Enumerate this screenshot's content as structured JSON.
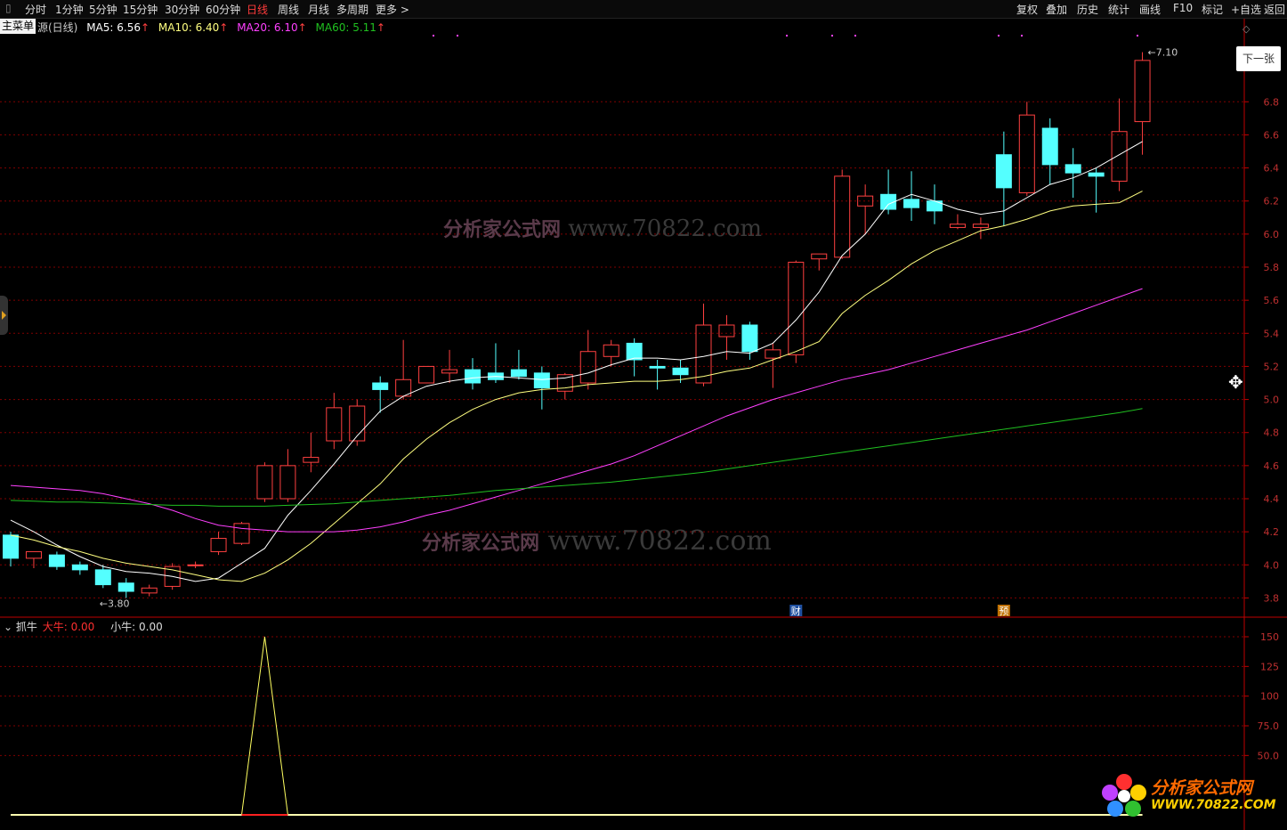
{
  "toolbar": {
    "periods": [
      "分时",
      "1分钟",
      "5分钟",
      "15分钟",
      "30分钟",
      "60分钟",
      "日线",
      "周线",
      "月线",
      "多周期",
      "更多 >"
    ],
    "active_period": "日线",
    "right_tools": [
      "复权",
      "叠加",
      "历史",
      "统计",
      "画线",
      "F10",
      "标记",
      "+自选",
      "返回"
    ]
  },
  "main_menu_label": "主菜单",
  "next_button_label": "下一张",
  "main_legend": {
    "title": "源(日线)",
    "ma5": "MA5: 6.56",
    "ma10": "MA10: 6.40",
    "ma20": "MA20: 6.10",
    "ma60": "MA60: 5.11"
  },
  "sub_legend": {
    "title": "抓牛",
    "big": "大牛: 0.00",
    "small": "小牛: 0.00"
  },
  "markers": {
    "cai": "财",
    "yu": "预"
  },
  "watermark": {
    "site": "www.70822.com",
    "brand": "分析家公式网",
    "brand_url": "WWW.70822.COM"
  },
  "colors": {
    "up": "#ff4040",
    "down": "#54ffff",
    "ma5": "#ffffff",
    "ma10": "#ffff80",
    "ma20": "#ff40ff",
    "ma60": "#20c020",
    "grid": "#800000",
    "axis": "#c00000"
  },
  "chart_data": [
    {
      "type": "candlestick",
      "title": "",
      "ylim": [
        3.7,
        7.2
      ],
      "yticks": [
        3.8,
        4.0,
        4.2,
        4.4,
        4.6,
        4.8,
        5.0,
        5.2,
        5.4,
        5.6,
        5.8,
        6.0,
        6.2,
        6.4,
        6.6,
        6.8
      ],
      "annotations": {
        "high": "7.10",
        "low": "3.80"
      },
      "ohlc": [
        [
          4.18,
          4.2,
          3.99,
          4.04
        ],
        [
          4.04,
          4.08,
          3.98,
          4.08
        ],
        [
          4.06,
          4.08,
          3.97,
          3.99
        ],
        [
          4.0,
          4.02,
          3.94,
          3.97
        ],
        [
          3.97,
          4.0,
          3.86,
          3.88
        ],
        [
          3.89,
          3.92,
          3.8,
          3.84
        ],
        [
          3.83,
          3.88,
          3.81,
          3.86
        ],
        [
          3.87,
          4.01,
          3.85,
          3.99
        ],
        [
          4.0,
          4.02,
          3.98,
          4.0
        ],
        [
          4.08,
          4.2,
          4.06,
          4.16
        ],
        [
          4.13,
          4.26,
          4.12,
          4.25
        ],
        [
          4.4,
          4.62,
          4.38,
          4.6
        ],
        [
          4.4,
          4.7,
          4.38,
          4.6
        ],
        [
          4.62,
          4.8,
          4.56,
          4.65
        ],
        [
          4.75,
          5.04,
          4.7,
          4.95
        ],
        [
          4.75,
          5.0,
          4.72,
          4.96
        ],
        [
          5.1,
          5.14,
          4.92,
          5.06
        ],
        [
          5.02,
          5.36,
          5.0,
          5.12
        ],
        [
          5.1,
          5.2,
          5.1,
          5.2
        ],
        [
          5.16,
          5.3,
          5.1,
          5.18
        ],
        [
          5.18,
          5.25,
          5.06,
          5.1
        ],
        [
          5.16,
          5.34,
          5.1,
          5.12
        ],
        [
          5.18,
          5.3,
          5.12,
          5.14
        ],
        [
          5.16,
          5.2,
          4.94,
          5.07
        ],
        [
          5.05,
          5.16,
          5.0,
          5.15
        ],
        [
          5.1,
          5.42,
          5.06,
          5.29
        ],
        [
          5.26,
          5.36,
          5.2,
          5.33
        ],
        [
          5.34,
          5.37,
          5.14,
          5.24
        ],
        [
          5.2,
          5.24,
          5.06,
          5.19
        ],
        [
          5.19,
          5.24,
          5.1,
          5.15
        ],
        [
          5.1,
          5.58,
          5.08,
          5.45
        ],
        [
          5.38,
          5.51,
          5.24,
          5.45
        ],
        [
          5.45,
          5.47,
          5.24,
          5.29
        ],
        [
          5.25,
          5.34,
          5.07,
          5.3
        ],
        [
          5.27,
          5.84,
          5.22,
          5.83
        ],
        [
          5.85,
          5.88,
          5.78,
          5.88
        ],
        [
          5.86,
          6.39,
          5.85,
          6.35
        ],
        [
          6.17,
          6.3,
          6.0,
          6.23
        ],
        [
          6.24,
          6.39,
          6.12,
          6.15
        ],
        [
          6.21,
          6.38,
          6.08,
          6.16
        ],
        [
          6.2,
          6.3,
          6.06,
          6.14
        ],
        [
          6.04,
          6.12,
          6.03,
          6.06
        ],
        [
          6.04,
          6.1,
          5.97,
          6.06
        ],
        [
          6.48,
          6.62,
          6.05,
          6.28
        ],
        [
          6.25,
          6.8,
          6.23,
          6.72
        ],
        [
          6.64,
          6.7,
          6.3,
          6.42
        ],
        [
          6.42,
          6.52,
          6.22,
          6.37
        ],
        [
          6.37,
          6.4,
          6.13,
          6.35
        ],
        [
          6.32,
          6.82,
          6.26,
          6.62
        ],
        [
          6.68,
          7.1,
          6.48,
          7.05
        ]
      ],
      "series": [
        {
          "name": "MA5",
          "values": [
            4.27,
            4.2,
            4.12,
            4.05,
            3.99,
            3.96,
            3.95,
            3.93,
            3.9,
            3.92,
            4.01,
            4.1,
            4.3,
            4.45,
            4.61,
            4.78,
            4.93,
            5.02,
            5.08,
            5.11,
            5.13,
            5.14,
            5.13,
            5.12,
            5.13,
            5.16,
            5.21,
            5.25,
            5.25,
            5.24,
            5.26,
            5.29,
            5.28,
            5.34,
            5.48,
            5.65,
            5.87,
            6.0,
            6.18,
            6.24,
            6.2,
            6.15,
            6.12,
            6.14,
            6.22,
            6.3,
            6.34,
            6.4,
            6.48,
            6.56
          ]
        },
        {
          "name": "MA10",
          "values": [
            4.18,
            4.15,
            4.11,
            4.08,
            4.04,
            4.01,
            3.99,
            3.97,
            3.94,
            3.91,
            3.9,
            3.95,
            4.03,
            4.13,
            4.25,
            4.37,
            4.49,
            4.64,
            4.76,
            4.86,
            4.94,
            5.0,
            5.04,
            5.06,
            5.07,
            5.09,
            5.1,
            5.11,
            5.11,
            5.12,
            5.14,
            5.17,
            5.19,
            5.24,
            5.29,
            5.35,
            5.52,
            5.63,
            5.72,
            5.82,
            5.9,
            5.96,
            6.02,
            6.05,
            6.09,
            6.14,
            6.17,
            6.18,
            6.19,
            6.26
          ]
        },
        {
          "name": "MA20",
          "values": [
            4.48,
            4.47,
            4.46,
            4.45,
            4.43,
            4.4,
            4.37,
            4.33,
            4.28,
            4.24,
            4.22,
            4.21,
            4.2,
            4.2,
            4.2,
            4.21,
            4.23,
            4.26,
            4.3,
            4.33,
            4.37,
            4.41,
            4.45,
            4.49,
            4.53,
            4.57,
            4.61,
            4.66,
            4.72,
            4.78,
            4.84,
            4.9,
            4.95,
            5.0,
            5.04,
            5.08,
            5.12,
            5.15,
            5.18,
            5.22,
            5.26,
            5.3,
            5.34,
            5.38,
            5.42,
            5.47,
            5.52,
            5.57,
            5.62,
            5.67
          ]
        },
        {
          "name": "MA60",
          "values": [
            4.39,
            4.385,
            4.38,
            4.38,
            4.375,
            4.37,
            4.365,
            4.36,
            4.36,
            4.355,
            4.355,
            4.355,
            4.36,
            4.365,
            4.37,
            4.38,
            4.39,
            4.4,
            4.41,
            4.42,
            4.435,
            4.45,
            4.46,
            4.47,
            4.48,
            4.49,
            4.5,
            4.515,
            4.53,
            4.545,
            4.56,
            4.58,
            4.6,
            4.62,
            4.64,
            4.66,
            4.68,
            4.7,
            4.72,
            4.74,
            4.76,
            4.78,
            4.8,
            4.82,
            4.84,
            4.86,
            4.88,
            4.9,
            4.92,
            4.945
          ]
        }
      ]
    },
    {
      "type": "line",
      "title": "",
      "ylim": [
        0,
        165
      ],
      "yticks": [
        50.0,
        75.0,
        100,
        125,
        150
      ],
      "series": [
        {
          "name": "大牛",
          "values": [
            0,
            0,
            0,
            0,
            0,
            0,
            0,
            0,
            0,
            0,
            0,
            150,
            0,
            0,
            0,
            0,
            0,
            0,
            0,
            0,
            0,
            0,
            0,
            0,
            0,
            0,
            0,
            0,
            0,
            0,
            0,
            0,
            0,
            0,
            0,
            0,
            0,
            0,
            0,
            0,
            0,
            0,
            0,
            0,
            0,
            0,
            0,
            0,
            0,
            0
          ]
        },
        {
          "name": "小牛",
          "values": [
            0,
            0,
            0,
            0,
            0,
            0,
            0,
            0,
            0,
            0,
            0,
            0,
            0,
            0,
            0,
            0,
            0,
            0,
            0,
            0,
            0,
            0,
            0,
            0,
            0,
            0,
            0,
            0,
            0,
            0,
            0,
            0,
            0,
            0,
            0,
            0,
            0,
            0,
            0,
            0,
            0,
            0,
            0,
            0,
            0,
            0,
            0,
            0,
            0,
            0
          ]
        }
      ]
    }
  ]
}
